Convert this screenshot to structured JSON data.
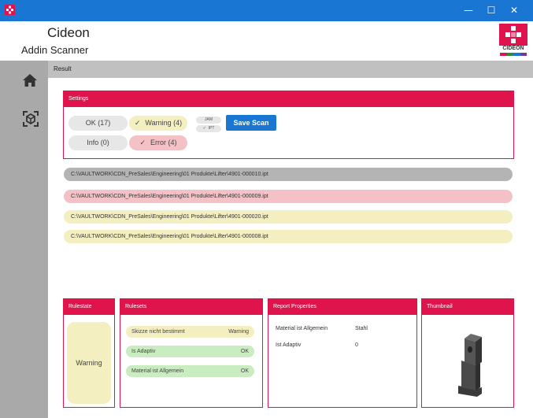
{
  "window": {
    "minimize_glyph": "—",
    "maximize_glyph": "☐",
    "close_glyph": "✕",
    "titlebar_color": "#1976d2"
  },
  "header": {
    "title": "Cideon",
    "subtitle": "Addin Scanner",
    "logo_text": "CIDEON"
  },
  "sidebar": {
    "items": [
      {
        "icon": "home-icon"
      },
      {
        "icon": "scan-icon"
      }
    ]
  },
  "main": {
    "result_label": "Result"
  },
  "settings": {
    "title": "Settings",
    "filters": {
      "ok": "OK (17)",
      "warning": "Warning (4)",
      "info": "Info (0)",
      "error": "Error (4)",
      "check": "✓"
    },
    "file_types": {
      "jam": "JAM",
      "ipt": "IPT",
      "check": "✓"
    },
    "save_label": "Save Scan"
  },
  "files": [
    {
      "path": "C:\\VAULTWORK\\CDN_PreSales\\Engineering\\01 Produkte\\Lifter\\4901-000010.ipt",
      "status": "selected",
      "color": "#b4b4b4"
    },
    {
      "path": "C:\\VAULTWORK\\CDN_PreSales\\Engineering\\01 Produkte\\Lifter\\4901-000009.ipt",
      "status": "error",
      "color": "#f3c1c6"
    },
    {
      "path": "C:\\VAULTWORK\\CDN_PreSales\\Engineering\\01 Produkte\\Lifter\\4901-000020.ipt",
      "status": "warning",
      "color": "#f3efc0"
    },
    {
      "path": "C:\\VAULTWORK\\CDN_PreSales\\Engineering\\01 Produkte\\Lifter\\4901-000008.ipt",
      "status": "warning",
      "color": "#f3efc0"
    }
  ],
  "rulestate": {
    "title": "Rulestate",
    "value": "Warning"
  },
  "rulesets": {
    "title": "Rulesets",
    "items": [
      {
        "name": "Skizze nicht bestimmt",
        "result": "Warning",
        "color": "#f3efc0"
      },
      {
        "name": "Is Adaptiv",
        "result": "OK",
        "color": "#c9edc0"
      },
      {
        "name": "Material ist Allgemein",
        "result": "OK",
        "color": "#c9edc0"
      }
    ]
  },
  "report": {
    "title": "Report Properties",
    "properties": [
      {
        "name": "Material ist Allgemein",
        "value": "Stahl"
      },
      {
        "name": "Ist Adaptiv",
        "value": "0"
      }
    ]
  },
  "thumbnail": {
    "title": "Thumbnail"
  },
  "colors": {
    "accent": "#e0144c",
    "primary": "#1976d2",
    "ok": "#c9edc0",
    "warning": "#f3efc0",
    "error": "#f3c1c6",
    "neutral": "#e7e7e7"
  }
}
